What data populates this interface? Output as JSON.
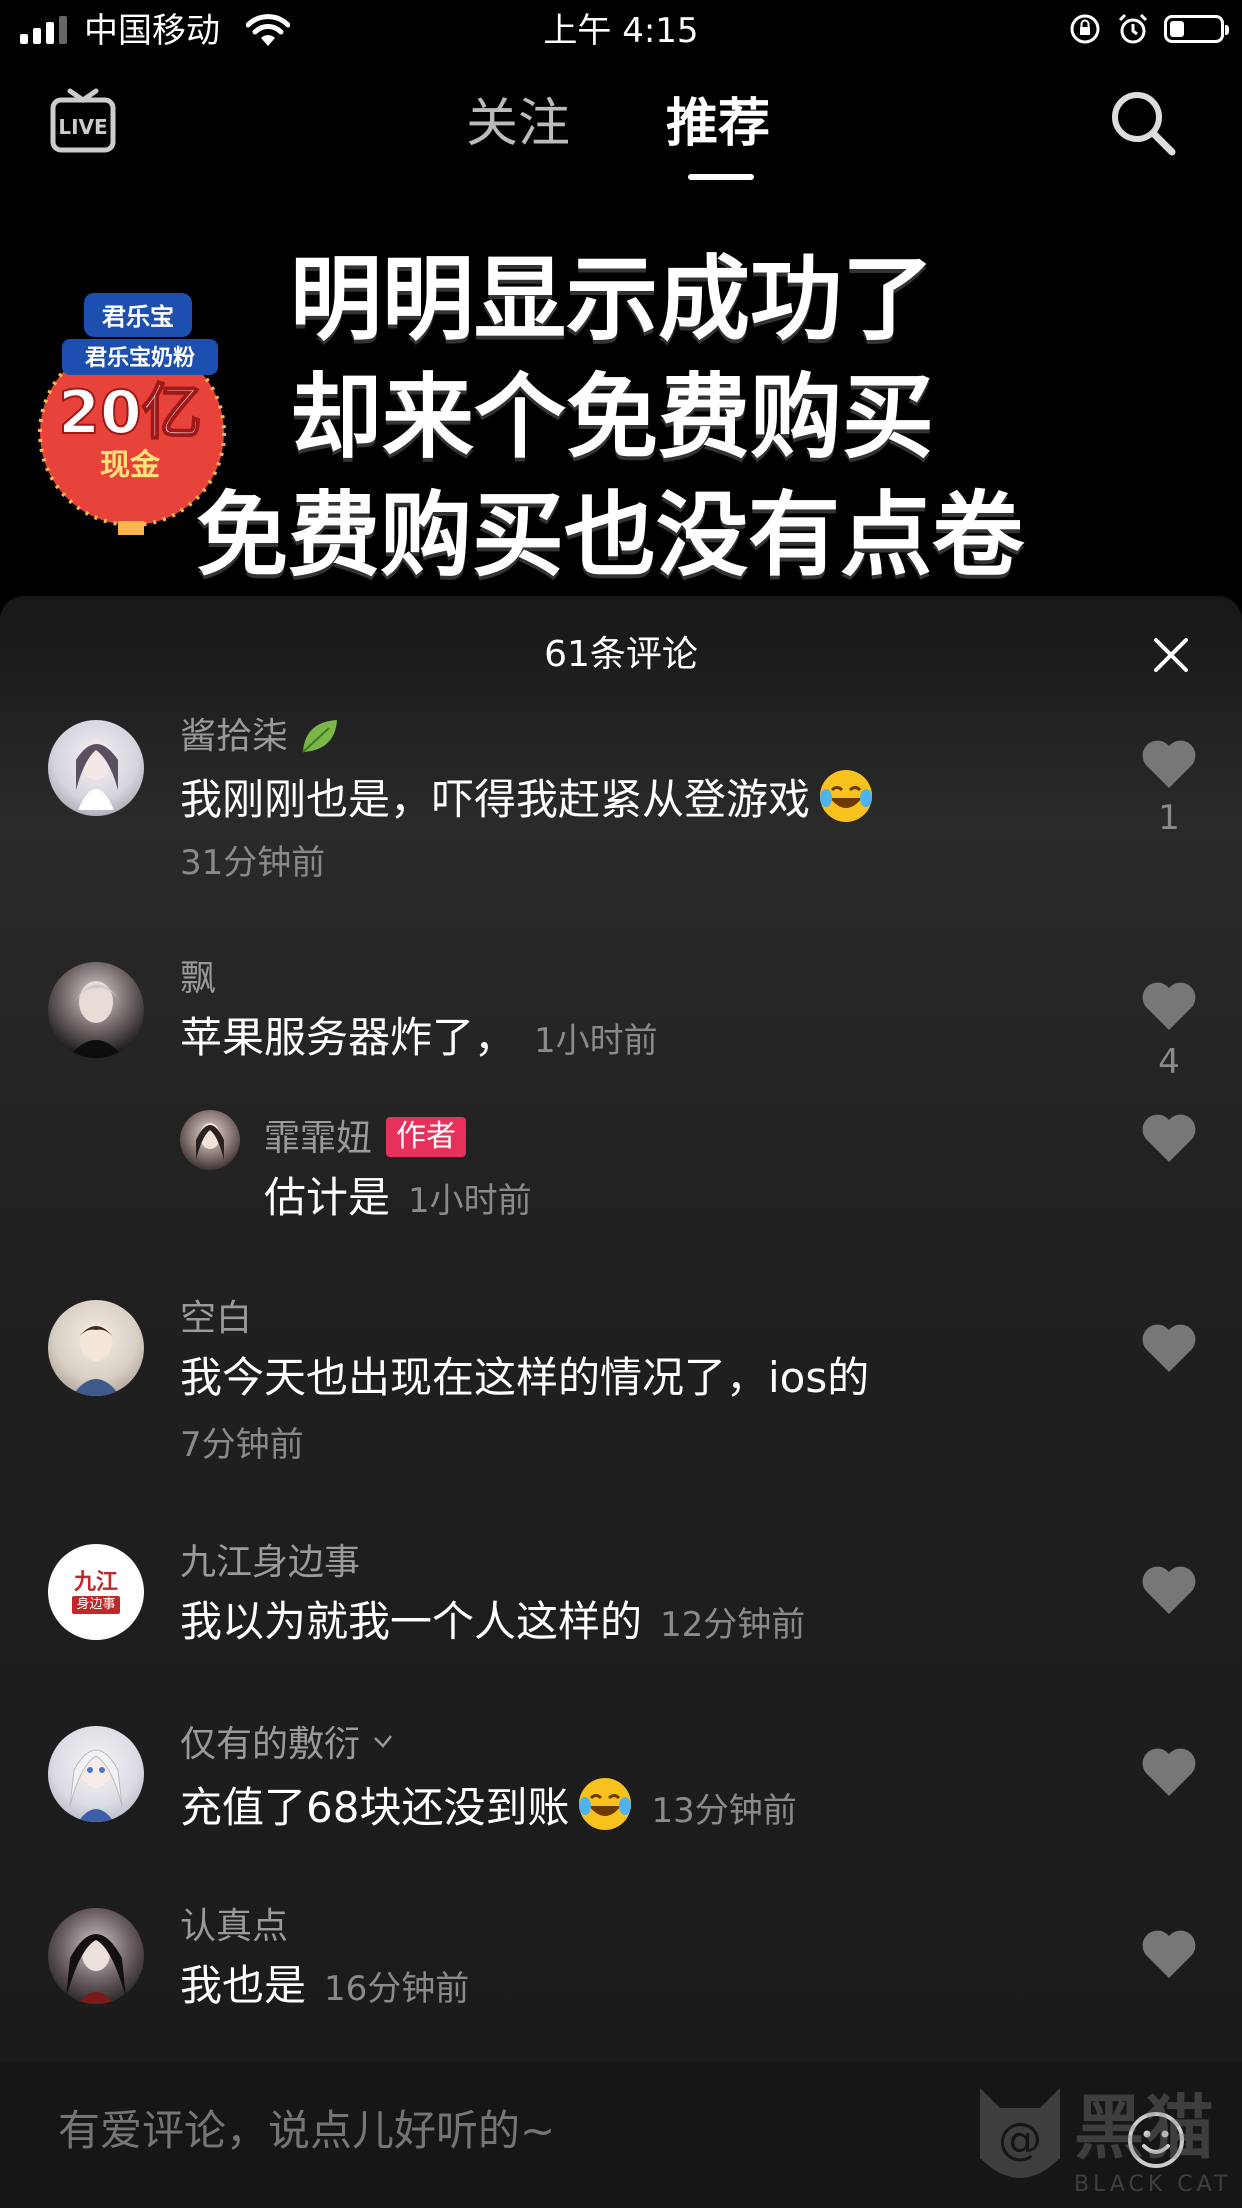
{
  "status_bar": {
    "carrier": "中国移动",
    "time": "上午 4:15",
    "battery_level": 0.3
  },
  "top_nav": {
    "live_label": "LIVE",
    "tabs": [
      {
        "label": "关注",
        "active": false
      },
      {
        "label": "推荐",
        "active": true
      }
    ]
  },
  "video": {
    "caption_lines": [
      "明明显示成功了",
      "却来个免费购买",
      "免费购买也没有点卷"
    ],
    "badge": {
      "brand": "君乐宝",
      "product": "君乐宝奶粉",
      "amount": "20亿",
      "unit": "现金"
    }
  },
  "comments_panel": {
    "title": "61条评论",
    "comments": [
      {
        "username": "酱拾柒",
        "text": "我刚刚也是，吓得我赶紧从登游戏",
        "emoji": "laughing-tears-emoji",
        "time": "31分钟前",
        "likes": "1"
      },
      {
        "username": "飘",
        "text": "苹果服务器炸了，",
        "time": "1小时前",
        "likes": "4"
      },
      {
        "username": "霏霏妞",
        "tag": "作者",
        "text": "估计是",
        "time": "1小时前",
        "reply": true
      },
      {
        "username": "空白",
        "text": "我今天也出现在这样的情况了，ios的",
        "time": "7分钟前"
      },
      {
        "username": "九江身边事",
        "text": "我以为就我一个人这样的",
        "time": "12分钟前",
        "avatar_text": [
          "九江",
          "身边事"
        ]
      },
      {
        "username": "仅有的敷衍",
        "text": "充值了68块还没到账",
        "emoji": "laughing-tears-emoji",
        "time": "13分钟前"
      },
      {
        "username": "认真点",
        "text": "我也是",
        "time": "16分钟前"
      }
    ]
  },
  "input_bar": {
    "placeholder": "有爱评论，说点儿好听的~"
  },
  "watermark": {
    "cn": "黑猫",
    "en": "BLACK CAT"
  },
  "colors": {
    "background": "#000000",
    "author_tag": "#e6325a",
    "secondary_text": "#8a8a8a"
  }
}
